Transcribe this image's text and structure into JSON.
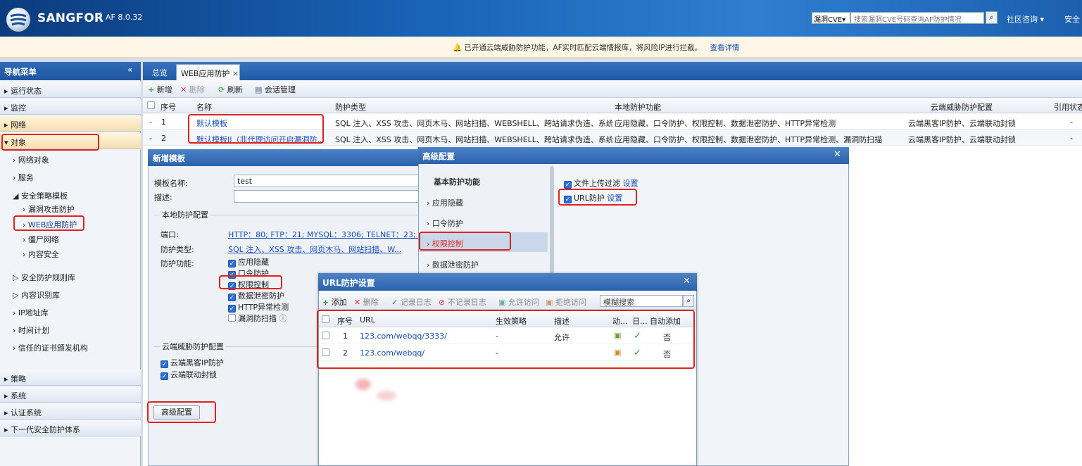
{
  "header": {
    "brand": "SANGFOR",
    "separator": "|",
    "version": "AF 8.0.32",
    "cve_select": "漏洞CVE",
    "cve_placeholder": "搜索漏洞CVE号码查询AF防护情况",
    "community": "社区咨询",
    "security": "安全"
  },
  "notice": {
    "text": "已开通云端威胁防护功能，AF实时匹配云端情报库，将风险IP进行拦截。",
    "link": "查看详情"
  },
  "nav": {
    "title": "导航菜单",
    "sections": [
      "运行状态",
      "监控",
      "网络",
      "对象"
    ],
    "object_items": [
      "网络对象",
      "服务",
      "安全策略模板",
      "漏洞攻击防护",
      "WEB应用防护",
      "僵尸网络",
      "内容安全",
      "安全防护规则库",
      "内容识别库",
      "IP地址库",
      "时间计划",
      "信任的证书颁发机构"
    ],
    "bottom_sections": [
      "策略",
      "系统",
      "认证系统",
      "下一代安全防护体系"
    ]
  },
  "tabs": {
    "overview": "总览",
    "web": "WEB应用防护"
  },
  "toolbar": {
    "add": "新增",
    "delete": "删除",
    "refresh": "刷新",
    "session": "会话管理"
  },
  "table": {
    "headers": [
      "序号",
      "名称",
      "防护类型",
      "本地防护功能",
      "云端威胁防护配置",
      "引用状态"
    ],
    "rows": [
      {
        "no": "1",
        "name": "默认模板",
        "type": "SQL 注入、XSS 攻击、网页木马、网站扫描、WEBSHELL、跨站请求伪造、系统...",
        "local": "应用隐藏、口令防护、权限控制、数据泄密防护、HTTP异常检测",
        "cloud": "云端黑客IP防护、云端联动封锁",
        "ref": "-"
      },
      {
        "no": "2",
        "name": "默认模板II（非代理访问开启漏洞防...",
        "type": "SQL 注入、XSS 攻击、网页木马、网站扫描、WEBSHELL、跨站请求伪造、系统...",
        "local": "应用隐藏、口令防护、权限控制、数据泄密防护、HTTP异常检测、漏洞防扫描",
        "cloud": "云端黑客IP防护、云端联动封锁",
        "ref": "-"
      }
    ]
  },
  "form": {
    "title": "新增模板",
    "name_label": "模板名称:",
    "name_value": "test",
    "desc_label": "描述:",
    "local_group": "本地防护配置",
    "port_label": "端口:",
    "port_value": "HTTP：80; FTP：21; MYSQL：3306; TELNET：23; ...",
    "type_label": "防护类型:",
    "type_value": "SQL 注入、XSS 攻击、网页木马、网站扫描、W...",
    "func_label": "防护功能:",
    "funcs": [
      "应用隐藏",
      "口令防护",
      "权限控制",
      "数据泄密防护",
      "HTTP异常检测",
      "漏洞防扫描"
    ],
    "cloud_group": "云端威胁防护配置",
    "cloud_funcs": [
      "云端黑客IP防护",
      "云端联动封锁"
    ],
    "adv_button": "高级配置"
  },
  "advanced": {
    "title": "高级配置",
    "heading": "基本防护功能",
    "items": [
      "应用隐藏",
      "口令防护",
      "权限控制",
      "数据泄密防护"
    ],
    "file_upload": "文件上传过滤",
    "url_protect": "URL防护",
    "setting": "设置"
  },
  "url_dialog": {
    "title": "URL防护设置",
    "toolbar": {
      "add": "添加",
      "delete": "删除",
      "log": "记录日志",
      "nolog": "不记录日志",
      "allow": "允许访问",
      "deny": "拒绝访问"
    },
    "search_placeholder": "模糊搜索",
    "headers": [
      "序号",
      "URL",
      "生效策略",
      "描述",
      "动...",
      "日...",
      "自动添加"
    ],
    "rows": [
      {
        "no": "1",
        "url": "123.com/webqq/3333/",
        "policy": "-",
        "desc": "允许",
        "auto": "否"
      },
      {
        "no": "2",
        "url": "123.com/webqq/",
        "policy": "-",
        "desc": "",
        "auto": "否"
      }
    ]
  },
  "colors": {
    "header": "#1a64b8",
    "highlight": "#e2221f",
    "link": "#1a4fb8"
  }
}
